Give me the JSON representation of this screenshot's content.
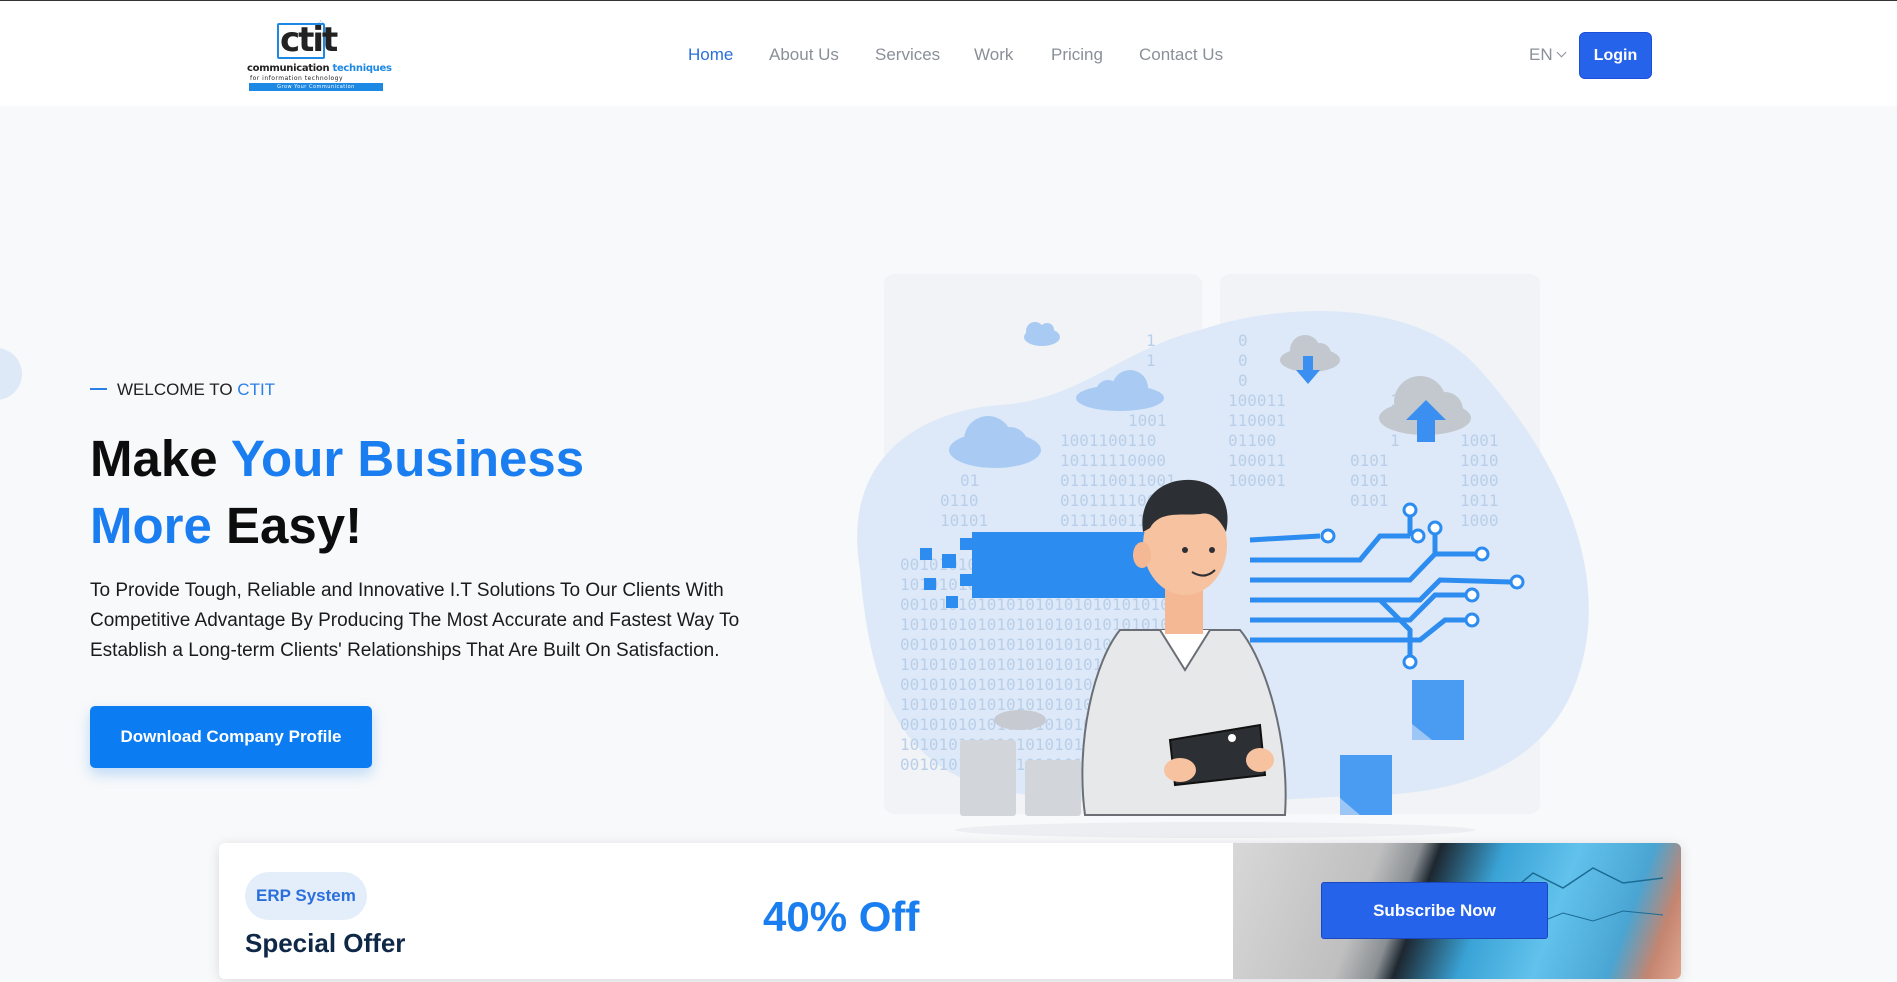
{
  "header": {
    "logo": {
      "mark": "ctit",
      "line1_a": "communication",
      "line1_b": "techniques",
      "line2": "for information technology",
      "line3": "Grow Your Communication"
    },
    "nav": [
      {
        "label": "Home",
        "active": true
      },
      {
        "label": "About Us",
        "active": false
      },
      {
        "label": "Services",
        "active": false
      },
      {
        "label": "Work",
        "active": false
      },
      {
        "label": "Pricing",
        "active": false
      },
      {
        "label": "Contact Us",
        "active": false
      }
    ],
    "language": "EN",
    "login_label": "Login"
  },
  "hero": {
    "welcome_prefix": "WELCOME TO",
    "welcome_brand": "CTIT",
    "title": {
      "part1": "Make ",
      "part2": "Your Business",
      "part3": "More",
      "part4": " Easy!"
    },
    "description": "To Provide Tough, Reliable and Innovative I.T Solutions To Our Clients With Competitive Advantage By Producing The Most Accurate and Fastest Way To Establish a Long-term Clients' Relationships That Are Built On Satisfaction.",
    "cta_label": "Download Company Profile"
  },
  "offer": {
    "tag": "ERP System",
    "title": "Special Offer",
    "discount": "40% Off",
    "subscribe_label": "Subscribe Now"
  },
  "colors": {
    "accent": "#1a7ef0",
    "button": "#2563eb",
    "nav_inactive": "#8a8f98",
    "background": "#f8f9fa"
  }
}
